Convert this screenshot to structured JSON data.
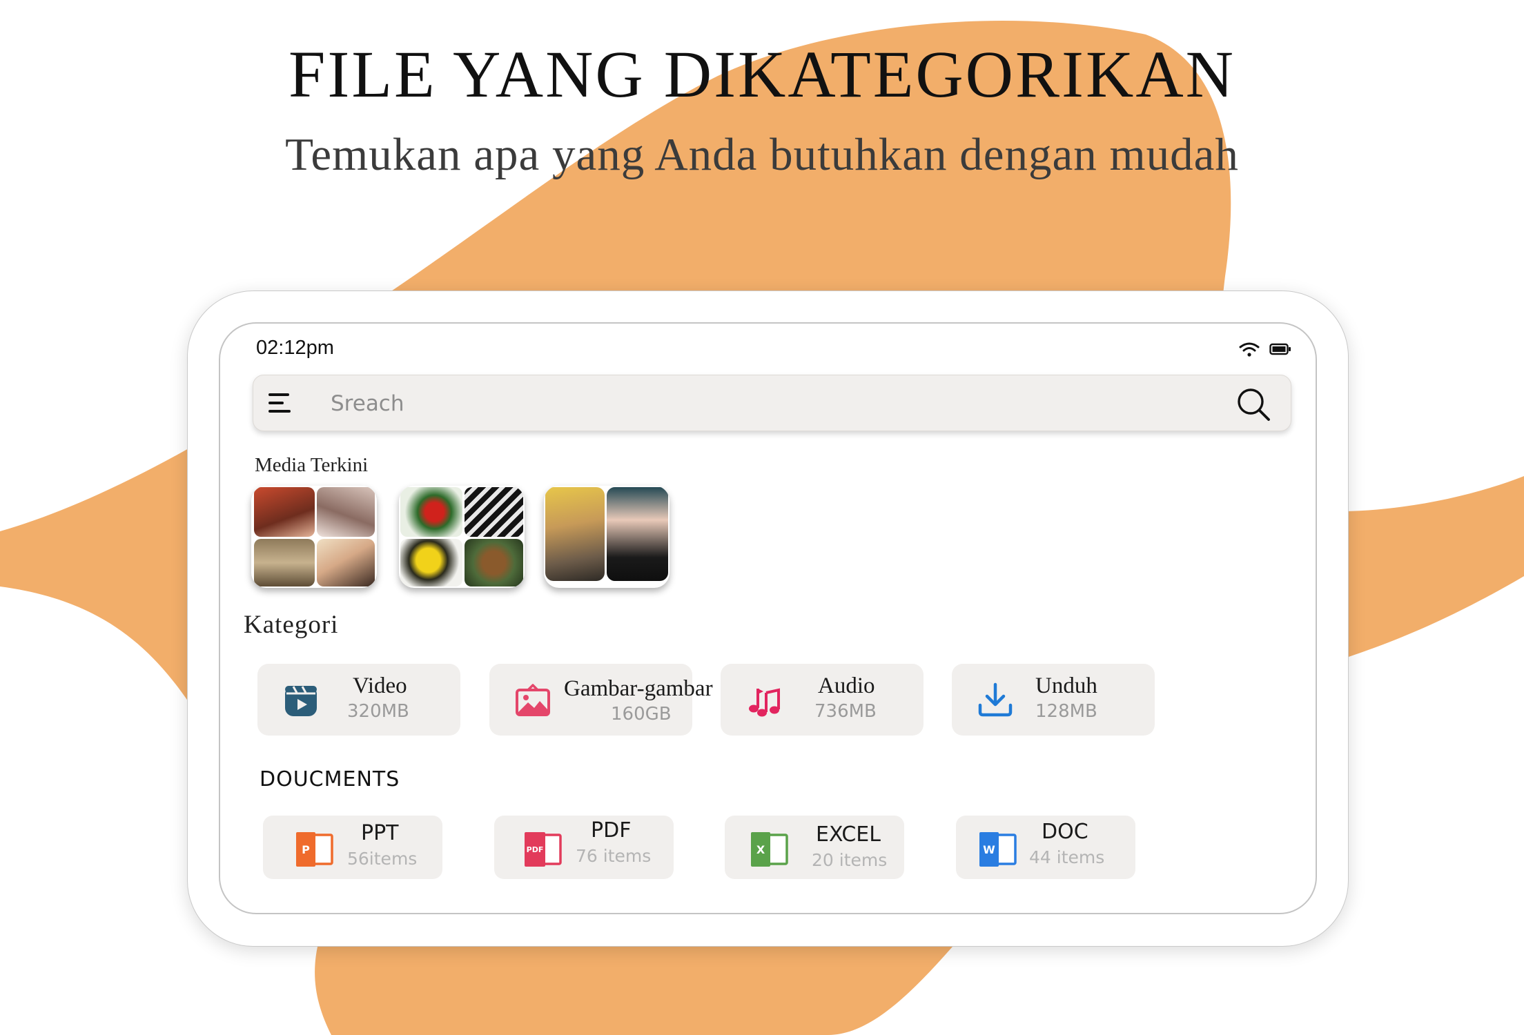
{
  "promo": {
    "title": "FILE YANG DIKATEGORIKAN",
    "subtitle": "Temukan apa yang Anda butuhkan dengan mudah"
  },
  "colors": {
    "accent_blob": "#f2ae6a",
    "card_bg": "#f1efed",
    "video_icon": "#2c5d79",
    "image_icon": "#e4466a",
    "audio_icon": "#e2255f",
    "download_icon": "#1f7ad6",
    "ppt": "#ef6b2c",
    "pdf": "#e23b5b",
    "excel": "#5aa24a",
    "doc": "#2a7de1"
  },
  "status_bar": {
    "time": "02:12pm",
    "icons": [
      "wifi-icon",
      "battery-icon"
    ]
  },
  "search": {
    "placeholder": "Sreach",
    "value": "",
    "icons": [
      "menu-icon",
      "search-icon"
    ]
  },
  "recent_media": {
    "title": "Media Terkini",
    "items": [
      {
        "name": "portraits-collage"
      },
      {
        "name": "birds-collage"
      },
      {
        "name": "fashion-collage"
      }
    ]
  },
  "categories": {
    "title": "Kategori",
    "items": [
      {
        "icon": "video-icon",
        "label": "Video",
        "size": "320MB"
      },
      {
        "icon": "image-icon",
        "label": "Gambar-gambar",
        "size": "160GB"
      },
      {
        "icon": "music-icon",
        "label": "Audio",
        "size": "736MB"
      },
      {
        "icon": "download-icon",
        "label": "Unduh",
        "size": "128MB"
      }
    ]
  },
  "documents": {
    "title": "DOUCMENTS",
    "items": [
      {
        "icon": "ppt-icon",
        "badge": "P",
        "label": "PPT",
        "count": "56items"
      },
      {
        "icon": "pdf-icon",
        "badge": "PDF",
        "label": "PDF",
        "count": "76 items"
      },
      {
        "icon": "excel-icon",
        "badge": "X",
        "label": "EXCEL",
        "count": "20 items"
      },
      {
        "icon": "word-icon",
        "badge": "W",
        "label": "DOC",
        "count": "44 items"
      }
    ]
  }
}
